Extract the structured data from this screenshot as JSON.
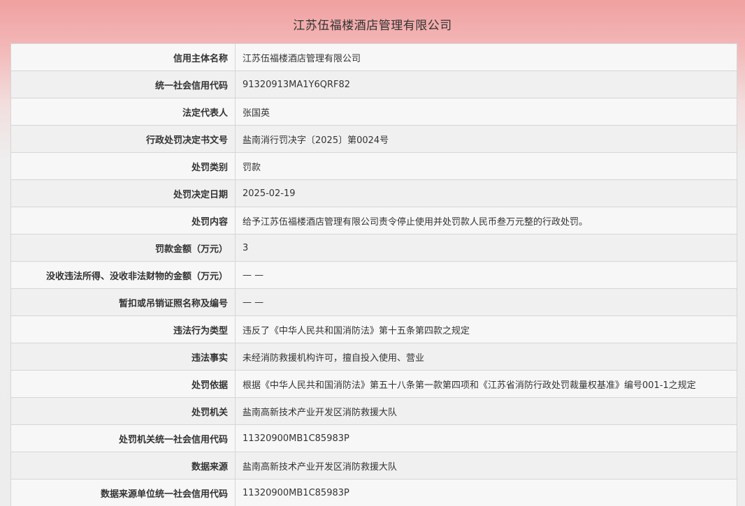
{
  "title": "江苏伍福楼酒店管理有限公司",
  "rows": [
    {
      "label": "信用主体名称",
      "value": "江苏伍福楼酒店管理有限公司"
    },
    {
      "label": "统一社会信用代码",
      "value": "91320913MA1Y6QRF82"
    },
    {
      "label": "法定代表人",
      "value": "张国英"
    },
    {
      "label": "行政处罚决定书文号",
      "value": "盐南消行罚决字〔2025〕第0024号"
    },
    {
      "label": "处罚类别",
      "value": "罚款"
    },
    {
      "label": "处罚决定日期",
      "value": "2025-02-19"
    },
    {
      "label": "处罚内容",
      "value": "给予江苏伍福楼酒店管理有限公司责令停止使用并处罚款人民币叁万元整的行政处罚。"
    },
    {
      "label": "罚款金额（万元）",
      "value": "3"
    },
    {
      "label": "没收违法所得、没收非法财物的金额（万元）",
      "value": "— —"
    },
    {
      "label": "暂扣或吊销证照名称及编号",
      "value": "— —"
    },
    {
      "label": "违法行为类型",
      "value": "违反了《中华人民共和国消防法》第十五条第四款之规定"
    },
    {
      "label": "违法事实",
      "value": "未经消防救援机构许可，擅自投入使用、营业"
    },
    {
      "label": "处罚依据",
      "value": "根据《中华人民共和国消防法》第五十八条第一款第四项和《江苏省消防行政处罚裁量权基准》编号001-1之规定"
    },
    {
      "label": "处罚机关",
      "value": "盐南高新技术产业开发区消防救援大队"
    },
    {
      "label": "处罚机关统一社会信用代码",
      "value": "11320900MB1C85983P"
    },
    {
      "label": "数据来源",
      "value": "盐南高新技术产业开发区消防救援大队"
    },
    {
      "label": "数据来源单位统一社会信用代码",
      "value": "11320900MB1C85983P"
    }
  ]
}
